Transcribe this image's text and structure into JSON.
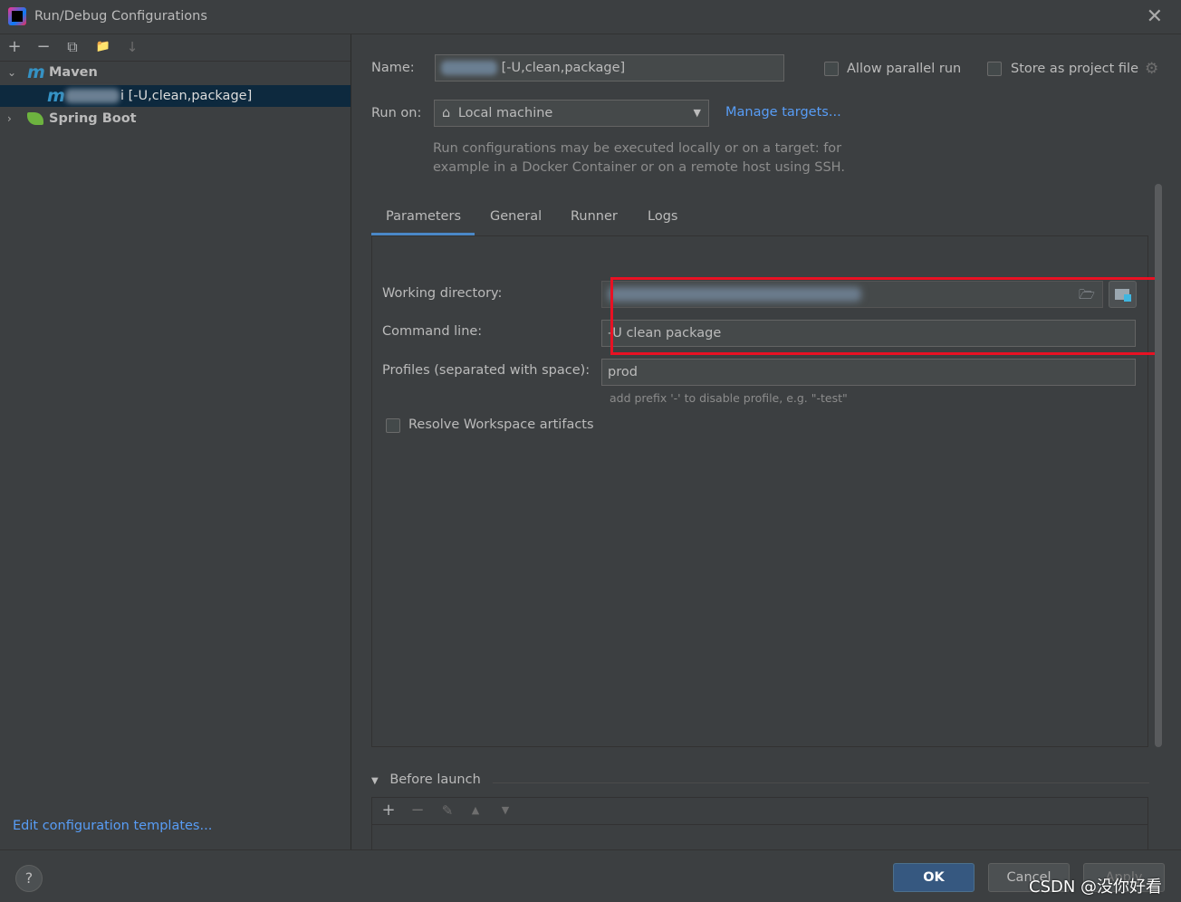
{
  "window": {
    "title": "Run/Debug Configurations",
    "close_glyph": "✕"
  },
  "toolbar": {
    "add": "+",
    "remove": "−",
    "copy": "⧉",
    "folder": "📁",
    "sort": "↓"
  },
  "tree": {
    "maven": {
      "label": "Maven",
      "icon": "m"
    },
    "maven_config": {
      "label_suffix": "i [-U,clean,package]",
      "icon": "m"
    },
    "spring_boot": {
      "label": "Spring Boot"
    }
  },
  "left_footer": {
    "edit_templates": "Edit configuration templates..."
  },
  "form": {
    "name_label": "Name:",
    "name_value": "[-U,clean,package]",
    "allow_parallel_run": "Allow parallel run",
    "store_as_project_file": "Store as project file",
    "run_on_label": "Run on:",
    "run_on_value": "Local machine",
    "manage_targets": "Manage targets...",
    "run_on_hint_line1": "Run configurations may be executed locally or on a target: for",
    "run_on_hint_line2": "example in a Docker Container or on a remote host using SSH."
  },
  "tabs": [
    "Parameters",
    "General",
    "Runner",
    "Logs"
  ],
  "parameters": {
    "working_directory_label": "Working directory:",
    "command_line_label": "Command line:",
    "command_line_value": "-U clean package",
    "profiles_label": "Profiles (separated with space):",
    "profiles_value": "prod",
    "profiles_hint": "add prefix '-' to disable profile, e.g. \"-test\"",
    "resolve_workspace": "Resolve Workspace artifacts"
  },
  "before_launch": {
    "label": "Before launch"
  },
  "buttons": {
    "help": "?",
    "ok": "OK",
    "cancel": "Cancel",
    "apply": "Apply"
  },
  "watermark": "CSDN @没你好看"
}
